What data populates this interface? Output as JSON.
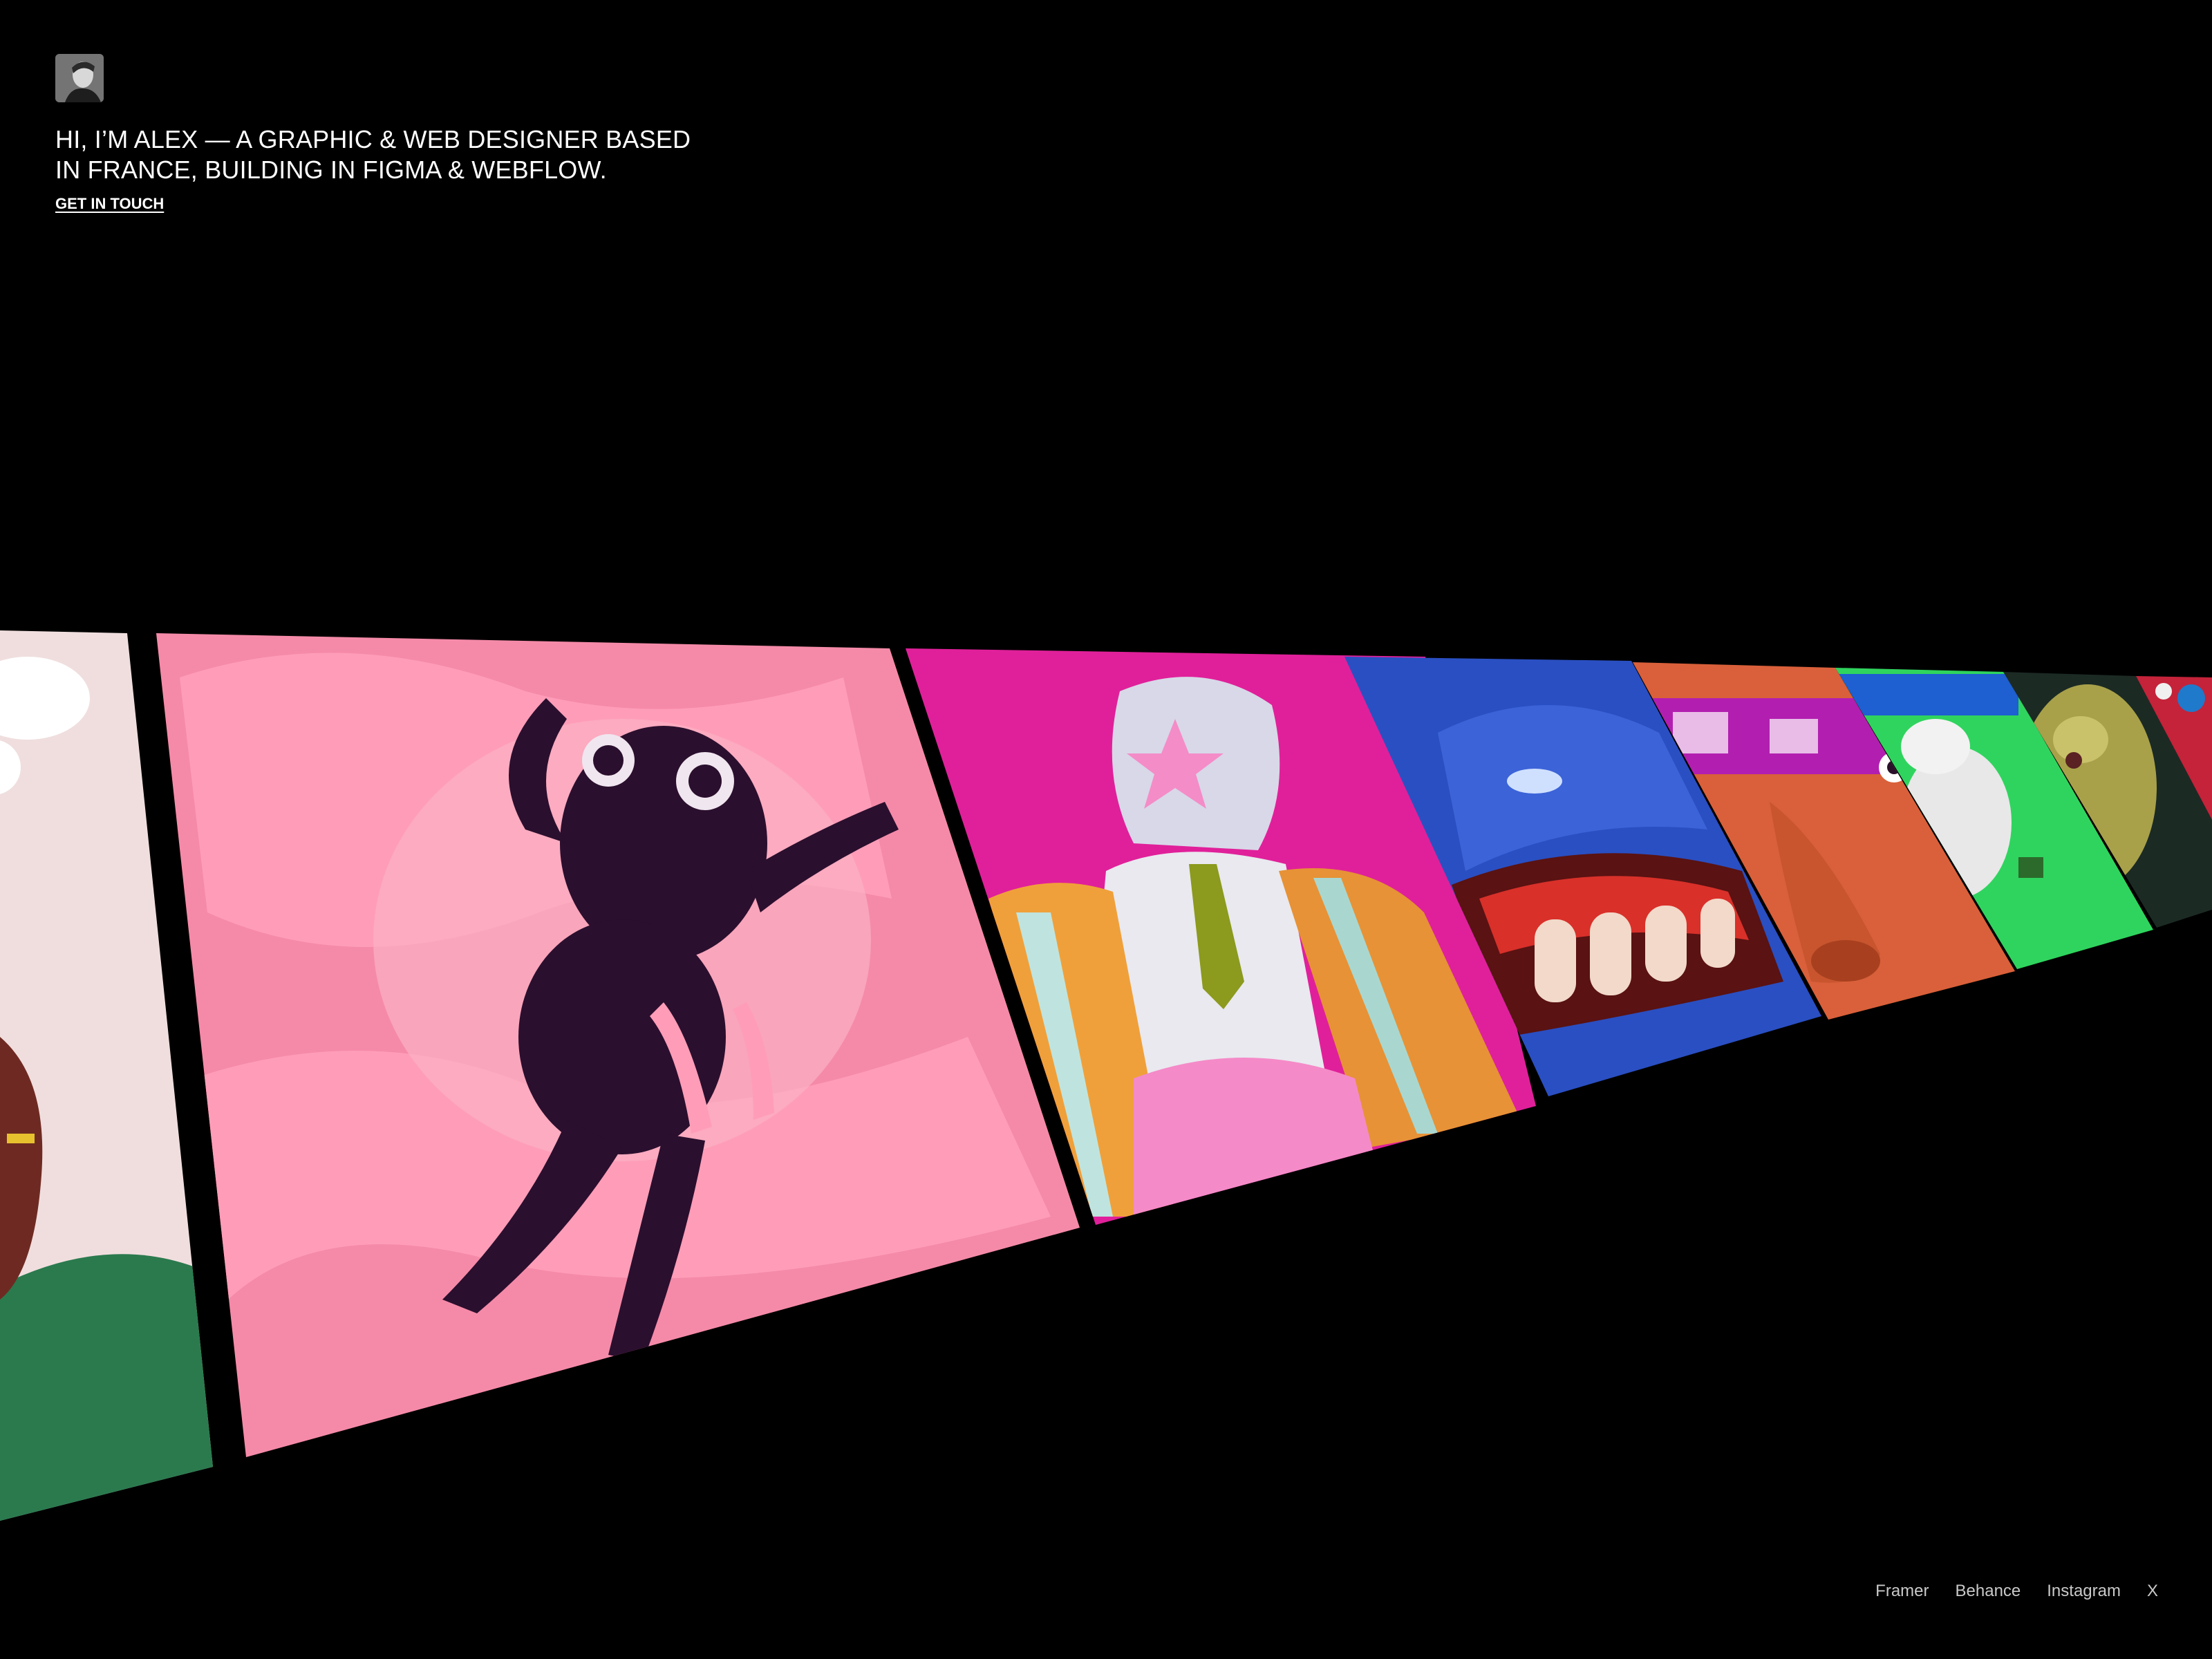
{
  "intro": {
    "headline_line1": "HI, I’M ALEX — A GRAPHIC & WEB DESIGNER BASED",
    "headline_line2": "IN FRANCE, BUILDING IN FIGMA & WEBFLOW.",
    "cta_label": "GET IN TOUCH"
  },
  "gallery": {
    "artworks": [
      {
        "name": "artwork-partial-cream",
        "bg": "#f0dede",
        "accent": "#2a7a4e"
      },
      {
        "name": "artwork-pink-blob-creature",
        "bg": "#f58aa8",
        "accent": "#2b0f2e"
      },
      {
        "name": "artwork-magenta-star-helmet",
        "bg": "#e0209a",
        "accent": "#e9e9ef"
      },
      {
        "name": "artwork-blue-lips",
        "bg": "#2a4fc2",
        "accent": "#f2d9c9"
      },
      {
        "name": "artwork-orange-face",
        "bg": "#d9603a",
        "accent": "#b21fb0"
      },
      {
        "name": "artwork-green-poster",
        "bg": "#2fd45e",
        "accent": "#e8e8e8"
      },
      {
        "name": "artwork-olive-creature",
        "bg": "#1c2a24",
        "accent": "#a8a14a"
      },
      {
        "name": "artwork-red-pattern",
        "bg": "#c4233a",
        "accent": "#1f7acb"
      }
    ]
  },
  "footer": {
    "links": [
      "Framer",
      "Behance",
      "Instagram",
      "X"
    ]
  }
}
